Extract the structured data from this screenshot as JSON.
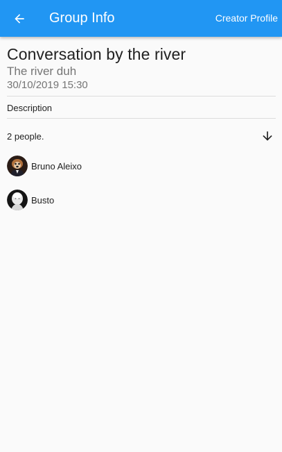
{
  "appbar": {
    "title": "Group Info",
    "action_label": "Creator Profile",
    "back_icon": "arrow-back-icon",
    "color": "#2196f3"
  },
  "group": {
    "name": "Conversation by the river",
    "subtitle": "The river duh",
    "date": "30/10/2019 15:30",
    "description_label": "Description"
  },
  "members": {
    "count_label": "2 people.",
    "expand_icon": "arrow-down-icon",
    "list": [
      {
        "name": "Bruno Aleixo"
      },
      {
        "name": "Busto"
      }
    ]
  }
}
